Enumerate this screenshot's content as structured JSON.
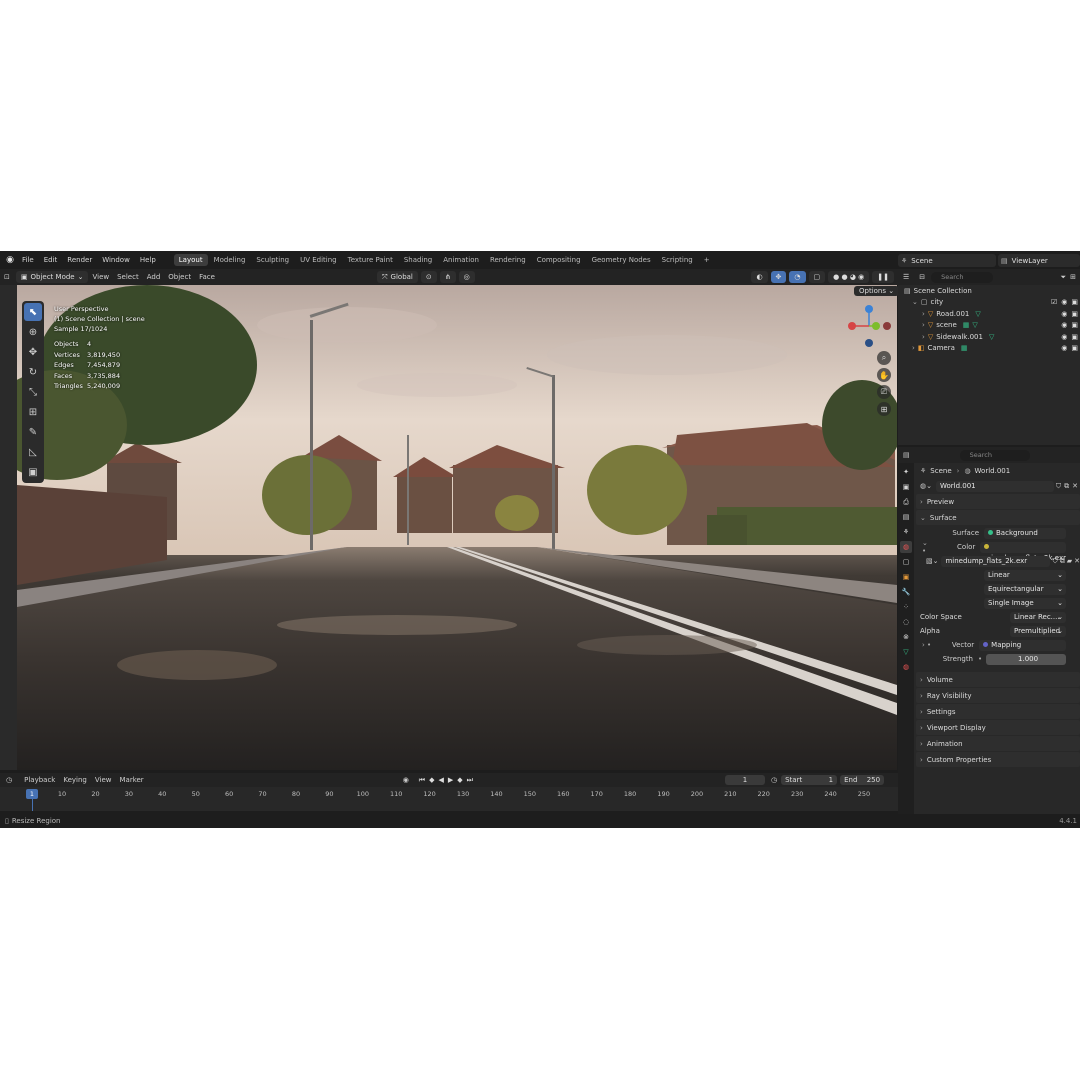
{
  "menu": [
    "File",
    "Edit",
    "Render",
    "Window",
    "Help"
  ],
  "workspaces": [
    "Layout",
    "Modeling",
    "Sculpting",
    "UV Editing",
    "Texture Paint",
    "Shading",
    "Animation",
    "Rendering",
    "Compositing",
    "Geometry Nodes",
    "Scripting"
  ],
  "active_workspace": "Layout",
  "scene_name": "Scene",
  "view_layer": "ViewLayer",
  "viewport": {
    "mode": "Object Mode",
    "menus": [
      "View",
      "Select",
      "Add",
      "Object",
      "Face"
    ],
    "orientation": "Global",
    "options": "Options",
    "perspective": "User Perspective",
    "collection_line": "(1) Scene Collection | scene",
    "sample": "Sample 17/1024",
    "stats": [
      {
        "label": "Objects",
        "value": "4"
      },
      {
        "label": "Vertices",
        "value": "3,819,450"
      },
      {
        "label": "Edges",
        "value": "7,454,879"
      },
      {
        "label": "Faces",
        "value": "3,735,884"
      },
      {
        "label": "Triangles",
        "value": "5,240,009"
      }
    ]
  },
  "timeline": {
    "menus": [
      "Playback",
      "Keying",
      "View",
      "Marker"
    ],
    "current_frame": "1",
    "start_label": "Start",
    "start": "1",
    "end_label": "End",
    "end": "250",
    "ticks": [
      "1",
      "10",
      "20",
      "30",
      "40",
      "50",
      "60",
      "70",
      "80",
      "90",
      "100",
      "110",
      "120",
      "130",
      "140",
      "150",
      "160",
      "170",
      "180",
      "190",
      "200",
      "210",
      "220",
      "230",
      "240",
      "250"
    ]
  },
  "status": {
    "left": "Resize Region",
    "version": "4.4.1"
  },
  "outliner": {
    "search_placeholder": "Search",
    "root": "Scene Collection",
    "collection": "city",
    "items": [
      "Road.001",
      "scene",
      "Sidewalk.001"
    ],
    "camera": "Camera"
  },
  "properties": {
    "search_placeholder": "Search",
    "breadcrumb_scene": "Scene",
    "breadcrumb_world": "World.001",
    "world_name": "World.001",
    "panels_top": [
      "Preview",
      "Surface"
    ],
    "surface_label": "Surface",
    "surface_value": "Background",
    "color_label": "Color",
    "color_value": "minedump_flats_2k.exr",
    "image_name": "minedump_flats_2k.exr",
    "interpolation": "Linear",
    "projection": "Equirectangular",
    "source": "Single Image",
    "color_space_label": "Color Space",
    "color_space": "Linear Rec....",
    "alpha_label": "Alpha",
    "alpha": "Premultiplied",
    "vector_label": "Vector",
    "vector_value": "Mapping",
    "strength_label": "Strength",
    "strength_value": "1.000",
    "panels_bottom": [
      "Volume",
      "Ray Visibility",
      "Settings",
      "Viewport Display",
      "Animation",
      "Custom Properties"
    ]
  }
}
